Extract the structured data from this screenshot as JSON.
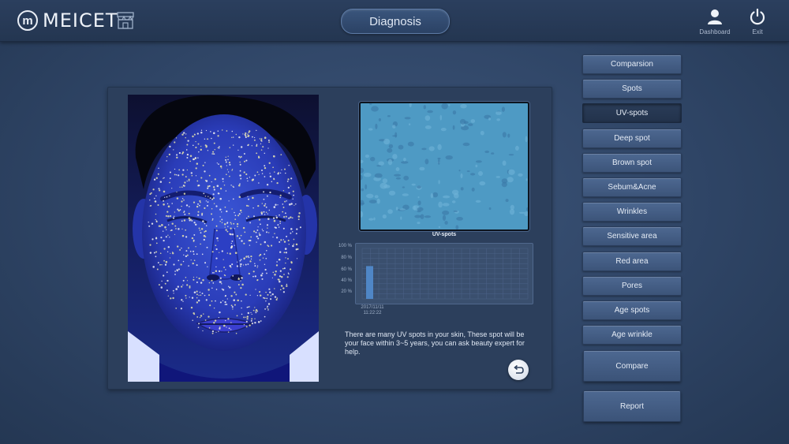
{
  "header": {
    "logo_mark": "m",
    "logo_text": "MEICET",
    "title": "Diagnosis",
    "dashboard_label": "Dashboard",
    "exit_label": "Exit"
  },
  "analysis": {
    "closeup_caption": "UV-spots",
    "chart_y_ticks": [
      "100 %",
      "80 %",
      "60 %",
      "40 %",
      "20 %"
    ],
    "chart_x_date": "2017/11/11",
    "chart_x_time": "11:22:22",
    "advice": "There are many UV spots in your skin, These spot will be your face within 3~5 years, you can ask beauty expert for help."
  },
  "chart_data": {
    "type": "bar",
    "categories": [
      "2017/11/11 11:22:22"
    ],
    "values": [
      65
    ],
    "ylim": [
      0,
      100
    ],
    "ylabel": "",
    "xlabel": "",
    "grid": true
  },
  "menu": {
    "items": [
      {
        "label": "Comparsion",
        "active": false
      },
      {
        "label": "Spots",
        "active": false
      },
      {
        "label": "UV-spots",
        "active": true
      },
      {
        "label": "Deep spot",
        "active": false
      },
      {
        "label": "Brown spot",
        "active": false
      },
      {
        "label": "Sebum&Acne",
        "active": false
      },
      {
        "label": "Wrinkles",
        "active": false
      },
      {
        "label": "Sensitive area",
        "active": false
      },
      {
        "label": "Red area",
        "active": false
      },
      {
        "label": "Pores",
        "active": false
      },
      {
        "label": "Age spots",
        "active": false
      },
      {
        "label": "Age wrinkle",
        "active": false
      }
    ],
    "compare_label": "Compare",
    "report_label": "Report"
  },
  "colors": {
    "background": "#2f4566",
    "bar": "#4f86c6",
    "uv_closeup": "#4e9ac4"
  }
}
